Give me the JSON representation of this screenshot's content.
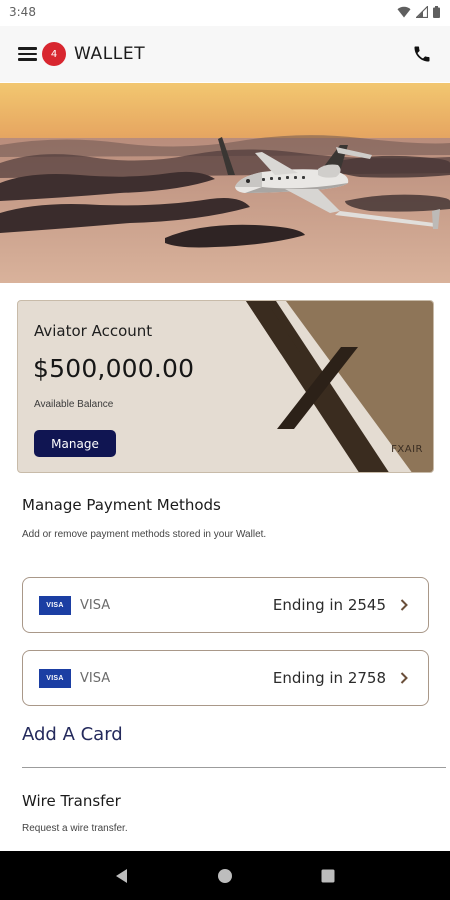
{
  "status_bar": {
    "time": "3:48"
  },
  "app_bar": {
    "badge_count": "4",
    "title": "WALLET"
  },
  "account": {
    "name": "Aviator Account",
    "balance": "$500,000.00",
    "balance_label": "Available Balance",
    "manage_label": "Manage",
    "brand": "FXAIR"
  },
  "payment_methods": {
    "title": "Manage Payment Methods",
    "subtitle": "Add or remove payment methods stored in your Wallet.",
    "cards": [
      {
        "brand_logo": "VISA",
        "brand_name": "VISA",
        "ending": "Ending in 2545"
      },
      {
        "brand_logo": "VISA",
        "brand_name": "VISA",
        "ending": "Ending in 2758"
      }
    ],
    "add_card_label": "Add A Card"
  },
  "wire_transfer": {
    "title": "Wire Transfer",
    "subtitle": "Request a wire transfer."
  },
  "colors": {
    "badge": "#d8262f",
    "manage_button": "#101552",
    "card_border": "#a99889",
    "add_card_text": "#242a5c",
    "account_card_bg": "#e4dcd2",
    "account_card_accent": "#8e7558"
  },
  "icons": {
    "menu": "hamburger-menu-icon",
    "phone": "phone-icon",
    "chevron": "chevron-right-icon",
    "wifi": "wifi-icon",
    "signal": "signal-icon",
    "battery": "battery-icon",
    "back": "back-triangle-icon",
    "home": "home-circle-icon",
    "recents": "recents-square-icon"
  }
}
